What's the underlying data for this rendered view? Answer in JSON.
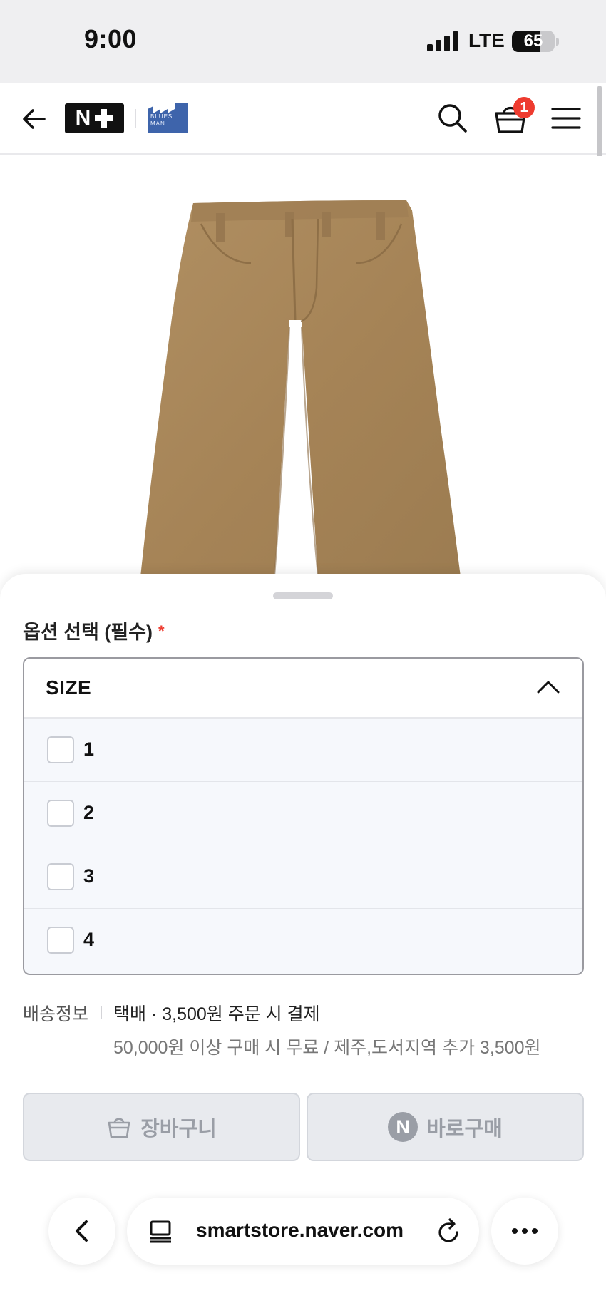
{
  "status_bar": {
    "time": "9:00",
    "network": "LTE",
    "battery_percent": "65",
    "battery_level": 0.65
  },
  "header": {
    "back_icon": "arrow-left-icon",
    "store_logo": "N+",
    "brand_logo_text": "BLUES MAN",
    "search_icon": "search-icon",
    "cart_icon": "shopping-bag-icon",
    "cart_count": "1",
    "menu_icon": "hamburger-menu-icon"
  },
  "product": {
    "image_subject": "pants"
  },
  "option_sheet": {
    "title": "옵션 선택 (필수)",
    "required_mark": "*",
    "dropdown": {
      "label": "SIZE",
      "expanded": true,
      "options": [
        {
          "label": "1",
          "checked": false
        },
        {
          "label": "2",
          "checked": false
        },
        {
          "label": "3",
          "checked": false
        },
        {
          "label": "4",
          "checked": false
        }
      ]
    }
  },
  "shipping": {
    "label": "배송정보",
    "main": "택배 · 3,500원 주문 시 결제",
    "sub": "50,000원 이상 구매 시 무료 / 제주,도서지역 추가 3,500원"
  },
  "actions": {
    "cart_button": "장바구니",
    "buy_button": "바로구매",
    "buy_badge": "N"
  },
  "browser": {
    "url": "smartstore.naver.com",
    "back_icon": "chevron-left-icon",
    "tabs_icon": "tabs-icon",
    "reload_icon": "reload-icon",
    "more_icon": "more-dots-icon"
  },
  "colors": {
    "accent_red": "#ee3b2f",
    "pants_khaki": "#a8865a",
    "brand_blue": "#3e64ab",
    "disabled_button": "#e8eaee"
  }
}
